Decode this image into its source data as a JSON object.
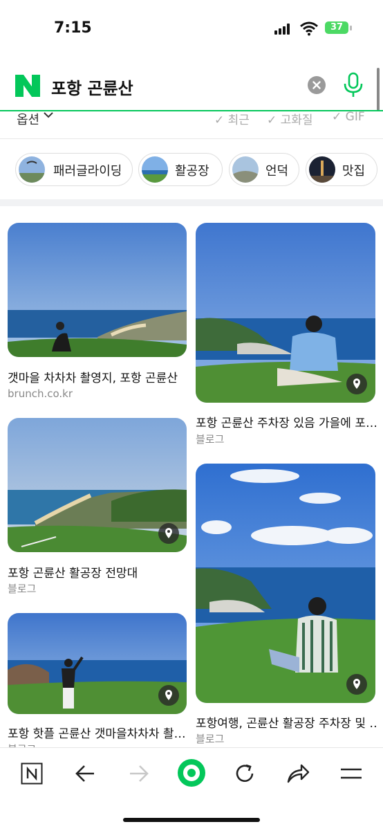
{
  "status_bar": {
    "time": "7:15",
    "battery": "37"
  },
  "search": {
    "query": "포항 곤륜산"
  },
  "options": {
    "label": "옵션",
    "filters": [
      "최근",
      "고화질",
      "GIF"
    ]
  },
  "chips": [
    {
      "label": "패러글라이딩"
    },
    {
      "label": "활공장"
    },
    {
      "label": "언덕"
    },
    {
      "label": "맛집"
    }
  ],
  "results": [
    {
      "title": "갯마을 차차차 촬영지, 포항 곤륜산",
      "source": "brunch.co.kr",
      "has_location": false
    },
    {
      "title": "포항 곤륜산 주차장 있음 가을에 포…",
      "source": "블로그",
      "has_location": true
    },
    {
      "title": "포항 곤륜산 활공장 전망대",
      "source": "블로그",
      "has_location": true
    },
    {
      "title": "포항여행, 곤륜산 활공장 주차장 및 …",
      "source": "블로그",
      "has_location": true
    },
    {
      "title": "포항 핫플 곤륜산 갯마을차차차 촬…",
      "source": "블로그",
      "has_location": true
    }
  ],
  "colors": {
    "brand_green": "#03c75a",
    "sky": "#5a8fd8",
    "grass": "#4f8a3a",
    "sea": "#1f5fa8"
  },
  "bottom_nav": [
    "n-home-icon",
    "back-arrow-icon",
    "forward-arrow-icon",
    "green-dot-icon",
    "refresh-icon",
    "share-icon",
    "menu-icon"
  ]
}
